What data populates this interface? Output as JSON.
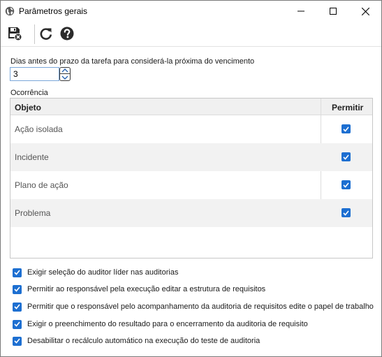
{
  "window": {
    "title": "Parâmetros gerais"
  },
  "toolbar": {
    "save_close_icon": "save-close-icon",
    "refresh_icon": "refresh-icon",
    "help_icon": "help-icon"
  },
  "form": {
    "days_label": "Dias antes do prazo da tarefa para considerá-la próxima do vencimento",
    "days_value": "3"
  },
  "occurrence": {
    "label": "Ocorrência",
    "columns": [
      "Objeto",
      "Permitir"
    ],
    "rows": [
      {
        "objeto": "Ação isolada",
        "permitir": true
      },
      {
        "objeto": "Incidente",
        "permitir": true
      },
      {
        "objeto": "Plano de ação",
        "permitir": true
      },
      {
        "objeto": "Problema",
        "permitir": true
      }
    ]
  },
  "options": [
    {
      "label": "Exigir seleção do auditor líder nas auditorias",
      "checked": true
    },
    {
      "label": "Permitir ao responsável pela execução editar a estrutura de requisitos",
      "checked": true
    },
    {
      "label": "Permitir que o responsável pelo acompanhamento da auditoria de requisitos edite o papel de trabalho",
      "checked": true
    },
    {
      "label": "Exigir o preenchimento do resultado para o encerramento da auditoria de requisito",
      "checked": true
    },
    {
      "label": "Desabilitar o recálculo automático na execução do teste de auditoria",
      "checked": true
    }
  ],
  "colors": {
    "accent": "#1d6fd1",
    "row_alt": "#f2f2f2",
    "header_bg": "#f0f0f0"
  }
}
